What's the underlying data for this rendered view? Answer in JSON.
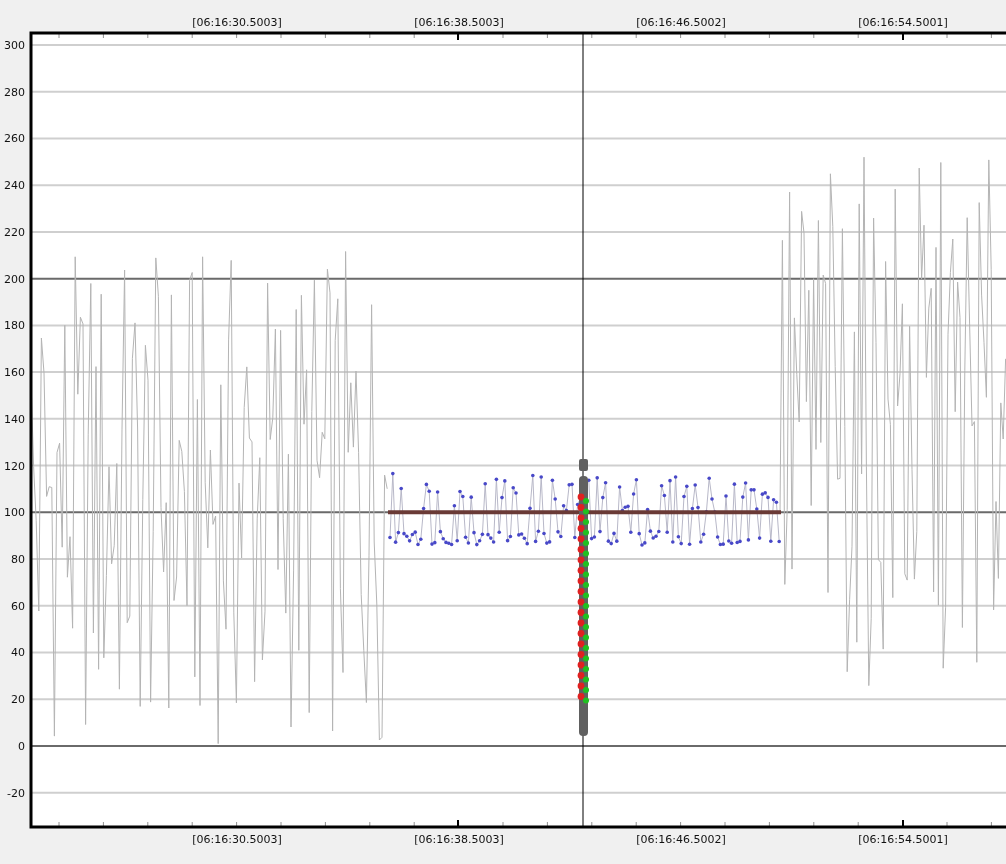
{
  "x_axis_top": {
    "labels": [
      "[06:16:30.5003]",
      "[06:16:38.5003]",
      "[06:16:46.5002]",
      "[06:16:54.5001]"
    ]
  },
  "y_axis": {
    "labels": [
      "300",
      "280",
      "260",
      "240",
      "220",
      "200",
      "180",
      "160",
      "140",
      "120",
      "100",
      "80",
      "60",
      "40",
      "20",
      "0",
      "-20"
    ]
  },
  "x_axis_bottom": {
    "labels": [
      "[06:16:30.5003]",
      "[06:16:38.5003]",
      "[06:16:46.5002]",
      "[06:16:54.5001]"
    ]
  }
}
